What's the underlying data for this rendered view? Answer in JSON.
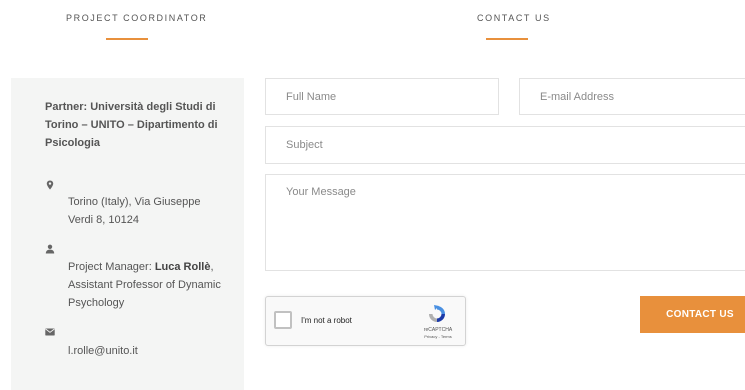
{
  "sections": {
    "coordinator_title": "Project Coordinator",
    "contact_title": "Contact Us"
  },
  "coordinator": {
    "partner": "Partner: Università degli Studi di Torino – UNITO – Dipartimento di Psicologia",
    "address": "Torino (Italy), Via Giuseppe Verdi 8, 10124",
    "manager_prefix": "Project Manager: ",
    "manager_name": "Luca Rollè",
    "manager_suffix": ", Assistant Professor of Dynamic Psychology",
    "email": "l.rolle@unito.it",
    "icons": [
      "map-marker-icon",
      "user-icon",
      "envelope-icon"
    ]
  },
  "form": {
    "full_name_placeholder": "Full Name",
    "email_placeholder": "E-mail Address",
    "subject_placeholder": "Subject",
    "message_placeholder": "Your Message",
    "captcha_label": "I'm not a robot",
    "captcha_brand": "reCAPTCHA",
    "captcha_terms": "Privacy - Terms",
    "submit_label": "Contact Us"
  },
  "colors": {
    "accent": "#e8903c",
    "panel_background": "#f4f5f4"
  }
}
